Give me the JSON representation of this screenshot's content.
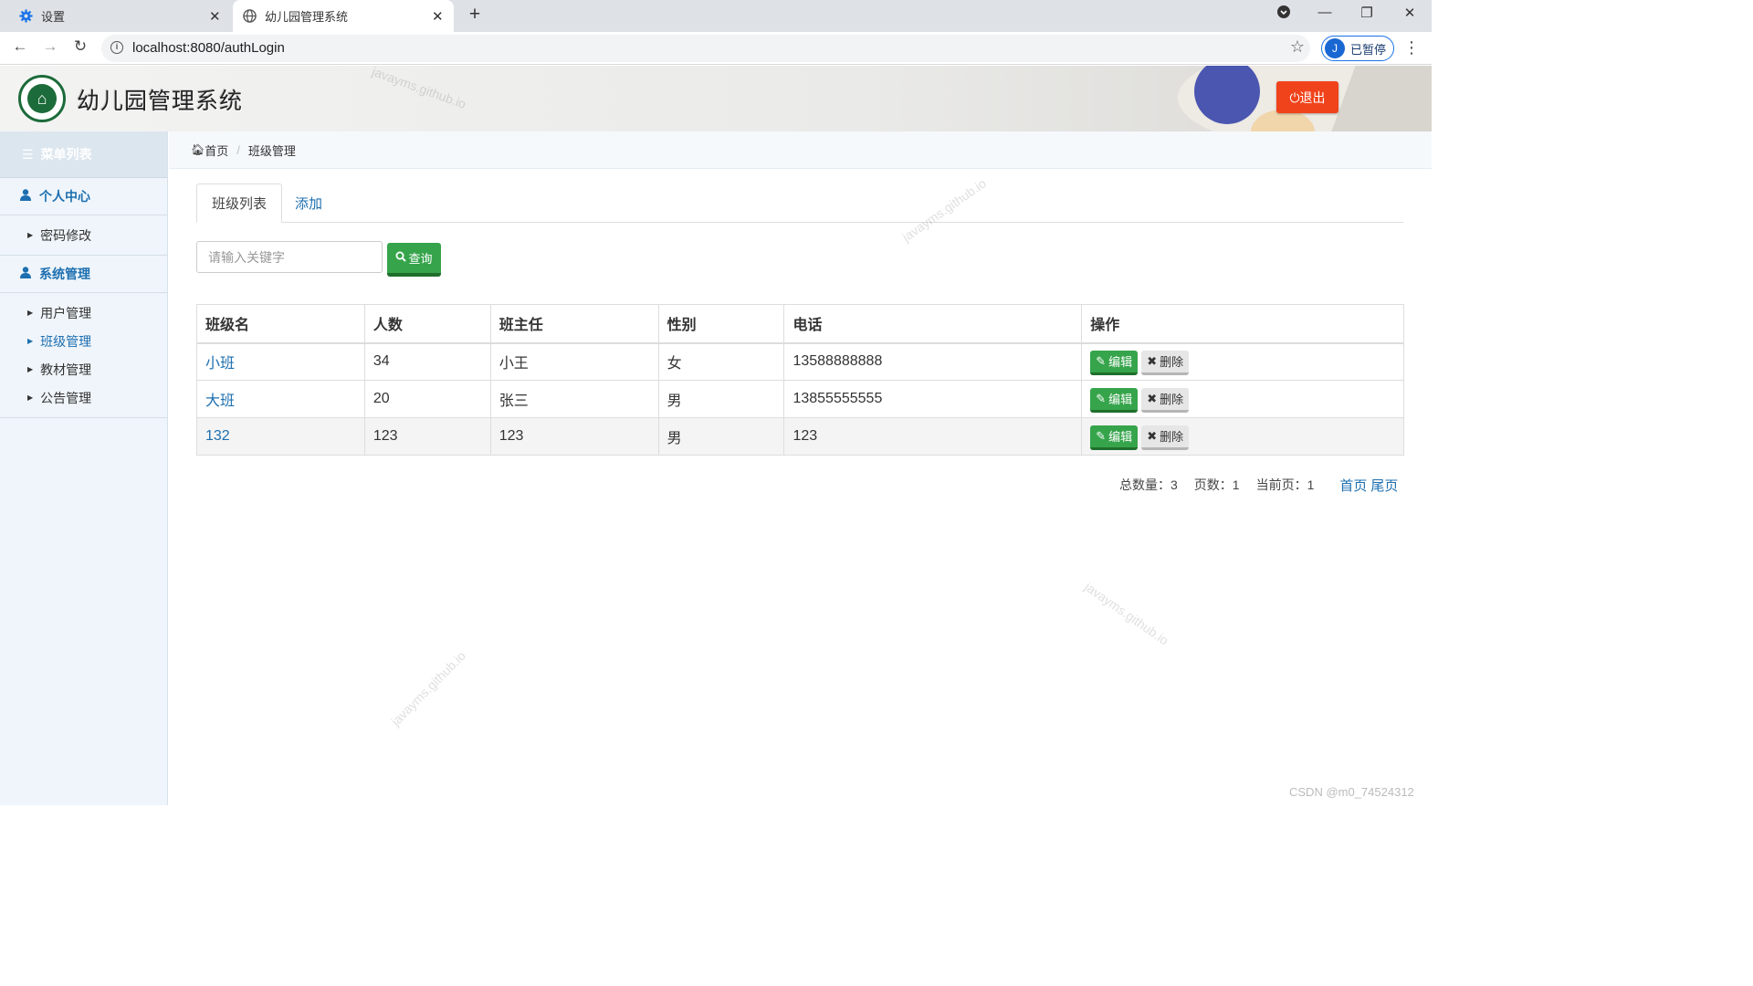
{
  "browser": {
    "tabs": [
      {
        "title": "设置",
        "close": "✕"
      },
      {
        "title": "幼儿园管理系统",
        "close": "✕"
      }
    ],
    "url": "localhost:8080/authLogin",
    "profile_initial": "J",
    "profile_label": "已暂停"
  },
  "app": {
    "title": "幼儿园管理系统",
    "logout_label": "⏻退出",
    "watermark": "javayms.github.io"
  },
  "sidebar": {
    "header": "菜单列表",
    "groups": [
      {
        "label": "个人中心",
        "items": [
          {
            "label": "密码修改"
          }
        ]
      },
      {
        "label": "系统管理",
        "items": [
          {
            "label": "用户管理"
          },
          {
            "label": "班级管理"
          },
          {
            "label": "教材管理"
          },
          {
            "label": "公告管理"
          }
        ]
      }
    ]
  },
  "breadcrumb": {
    "home": "首页",
    "current": "班级管理"
  },
  "tabs": {
    "list": "班级列表",
    "add": "添加"
  },
  "search": {
    "placeholder": "请输入关键字",
    "button": "查询"
  },
  "table": {
    "headers": [
      "班级名",
      "人数",
      "班主任",
      "性别",
      "电话",
      "操作"
    ],
    "rows": [
      {
        "name": "小班",
        "count": "34",
        "teacher": "小王",
        "gender": "女",
        "phone": "13588888888"
      },
      {
        "name": "大班",
        "count": "20",
        "teacher": "张三",
        "gender": "男",
        "phone": "13855555555"
      },
      {
        "name": "132",
        "count": "123",
        "teacher": "123",
        "gender": "男",
        "phone": "123"
      }
    ],
    "edit_label": "编辑",
    "delete_label": "删除"
  },
  "pager": {
    "total": "总数量：3",
    "pages": "页数：1",
    "current": "当前页：1",
    "first": "首页",
    "last": "尾页"
  },
  "footer_credit": "CSDN @m0_74524312",
  "colors": {
    "accent": "#1d6fb0",
    "success": "#36a44b",
    "danger": "#f0431c",
    "sidebar_bg": "#eff5fa"
  }
}
